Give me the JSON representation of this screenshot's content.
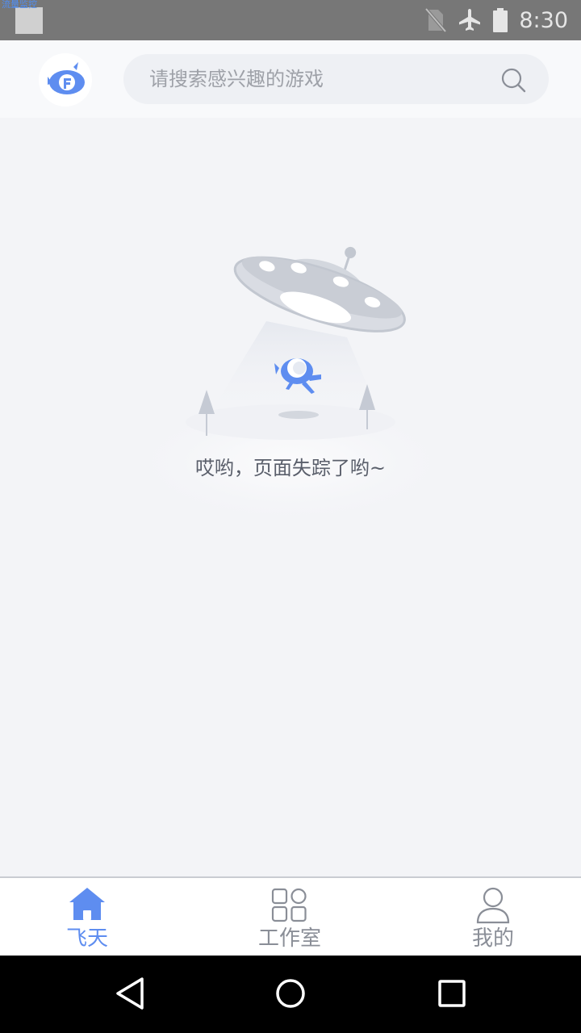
{
  "status_bar": {
    "overlay_text": "流量监控",
    "time": "8:30",
    "icons": [
      "no-sim-icon",
      "airplane-mode-icon",
      "battery-icon"
    ]
  },
  "header": {
    "logo_icon": "feitian-logo-icon",
    "search_placeholder": "请搜索感兴趣的游戏",
    "search_icon": "search-icon"
  },
  "empty_state": {
    "illustration": "ufo-abduction-illustration",
    "message": "哎哟，页面失踪了哟~"
  },
  "tabs": [
    {
      "label": "飞天",
      "icon": "home-icon",
      "active": true
    },
    {
      "label": "工作室",
      "icon": "grid-icon",
      "active": false
    },
    {
      "label": "我的",
      "icon": "user-icon",
      "active": false
    }
  ],
  "nav_bar": {
    "buttons": [
      "back-icon",
      "home-circle-icon",
      "recents-icon"
    ]
  },
  "colors": {
    "accent": "#5e8df0",
    "background": "#f3f4f7",
    "status_bar": "#777777",
    "tab_inactive": "#8a8e97"
  }
}
